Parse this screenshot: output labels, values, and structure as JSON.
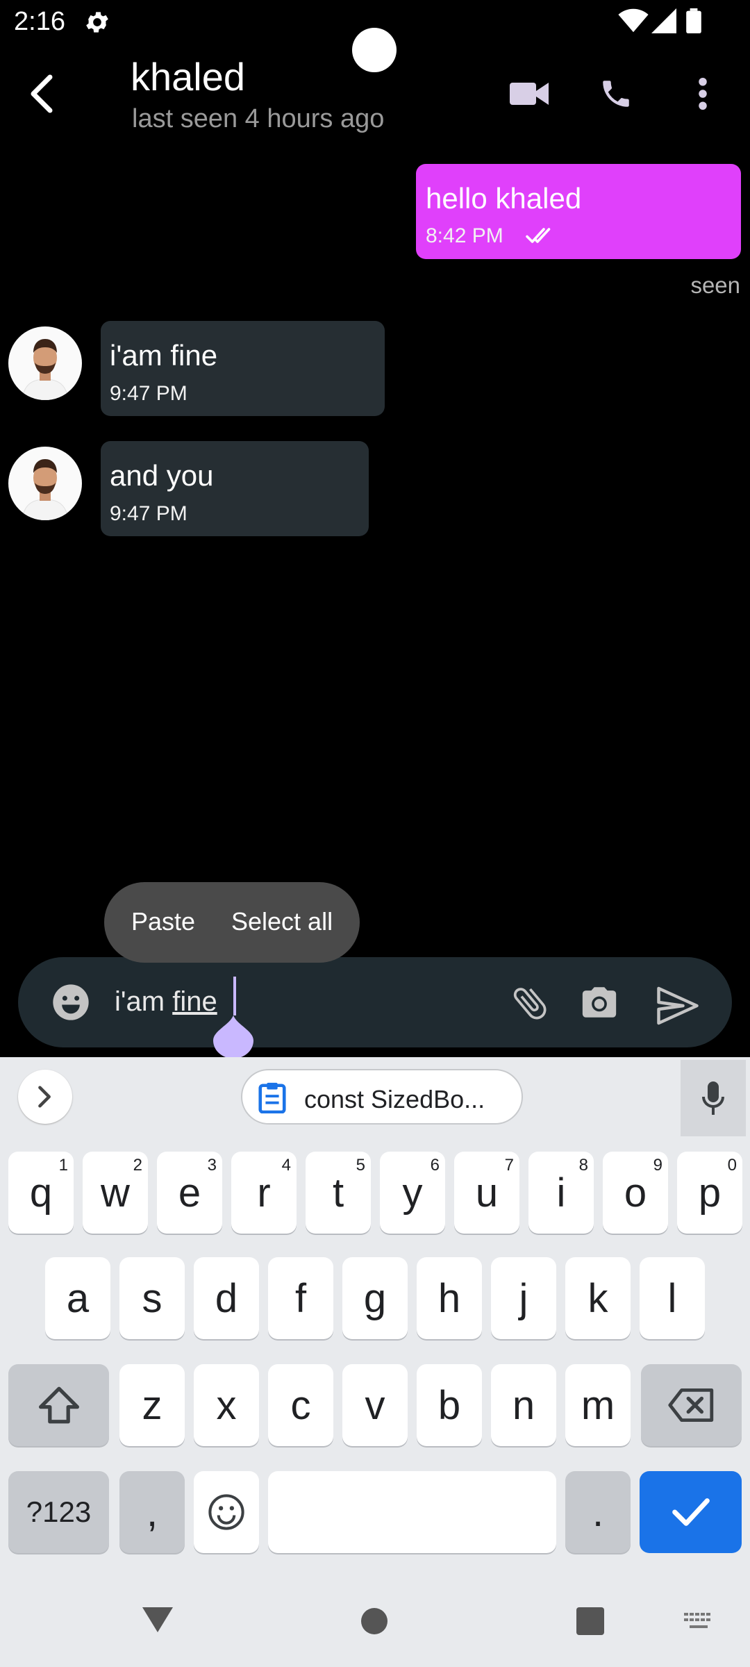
{
  "status_bar": {
    "time": "2:16"
  },
  "header": {
    "contact_name": "khaled",
    "contact_status": "last seen 4 hours ago"
  },
  "messages": [
    {
      "text": "hello khaled",
      "time": "8:42 PM",
      "status": "seen",
      "outgoing": true
    },
    {
      "text": "i'am fine",
      "time": "9:47 PM",
      "outgoing": false
    },
    {
      "text": "and you",
      "time": "9:47 PM",
      "outgoing": false
    }
  ],
  "context_menu": {
    "paste": "Paste",
    "select_all": "Select all"
  },
  "input": {
    "prefix": "i'am ",
    "underlined_word": "fine"
  },
  "keyboard": {
    "clipboard_suggestion": "const SizedBo...",
    "row1": [
      {
        "key": "q",
        "num": "1"
      },
      {
        "key": "w",
        "num": "2"
      },
      {
        "key": "e",
        "num": "3"
      },
      {
        "key": "r",
        "num": "4"
      },
      {
        "key": "t",
        "num": "5"
      },
      {
        "key": "y",
        "num": "6"
      },
      {
        "key": "u",
        "num": "7"
      },
      {
        "key": "i",
        "num": "8"
      },
      {
        "key": "o",
        "num": "9"
      },
      {
        "key": "p",
        "num": "0"
      }
    ],
    "row2": [
      "a",
      "s",
      "d",
      "f",
      "g",
      "h",
      "j",
      "k",
      "l"
    ],
    "row3": [
      "z",
      "x",
      "c",
      "v",
      "b",
      "n",
      "m"
    ],
    "symbols_key": "?123",
    "comma_key": ",",
    "period_key": "."
  },
  "colors": {
    "outgoing_bubble": "#e040fb",
    "incoming_bubble": "#262e33",
    "input_bar": "#1f2a30",
    "enter_key": "#1a73e8",
    "cursor_handle": "#c9b8ff"
  }
}
